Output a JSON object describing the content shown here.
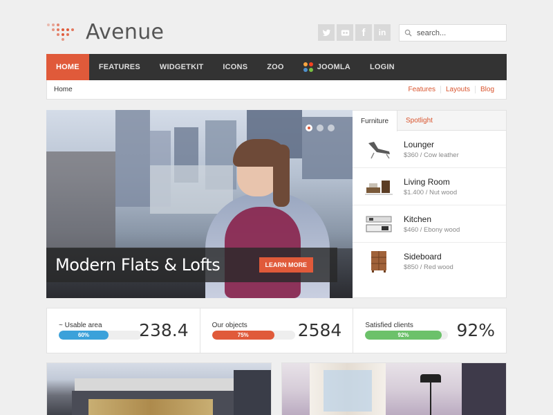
{
  "brand": {
    "name": "Avenue",
    "accent": "#e05a3a"
  },
  "social": [
    {
      "name": "twitter",
      "glyph": ""
    },
    {
      "name": "flickr",
      "glyph": ""
    },
    {
      "name": "facebook",
      "glyph": "f"
    },
    {
      "name": "linkedin",
      "glyph": "in"
    }
  ],
  "search": {
    "placeholder": "search..."
  },
  "nav": {
    "items": [
      "Home",
      "Features",
      "WidgetKit",
      "Icons",
      "Zoo",
      "Joomla",
      "Login"
    ],
    "active": "Home"
  },
  "breadcrumb": {
    "current": "Home",
    "links": [
      "Features",
      "Layouts",
      "Blog"
    ]
  },
  "slider": {
    "title": "Modern Flats & Lofts",
    "button": "Learn More",
    "slides": 3,
    "active_slide": 1
  },
  "tabs": {
    "items": [
      "Furniture",
      "Spotlight"
    ],
    "active": "Furniture",
    "products": [
      {
        "name": "Lounger",
        "meta": "$360 / Cow leather",
        "icon": "lounger-chair-icon"
      },
      {
        "name": "Living Room",
        "meta": "$1.400 / Nut wood",
        "icon": "living-room-icon"
      },
      {
        "name": "Kitchen",
        "meta": "$460 / Ebony wood",
        "icon": "kitchen-icon"
      },
      {
        "name": "Sideboard",
        "meta": "$850 / Red wood",
        "icon": "sideboard-icon"
      }
    ]
  },
  "stats": [
    {
      "label": "~ Usable area",
      "percent": 60,
      "percent_label": "60%",
      "value": "238.4",
      "color": "#3ba1da"
    },
    {
      "label": "Our objects",
      "percent": 75,
      "percent_label": "75%",
      "value": "2584",
      "color": "#e05a3a"
    },
    {
      "label": "Satisfied clients",
      "percent": 92,
      "percent_label": "92%",
      "value": "92%",
      "color": "#6cc16a"
    }
  ]
}
